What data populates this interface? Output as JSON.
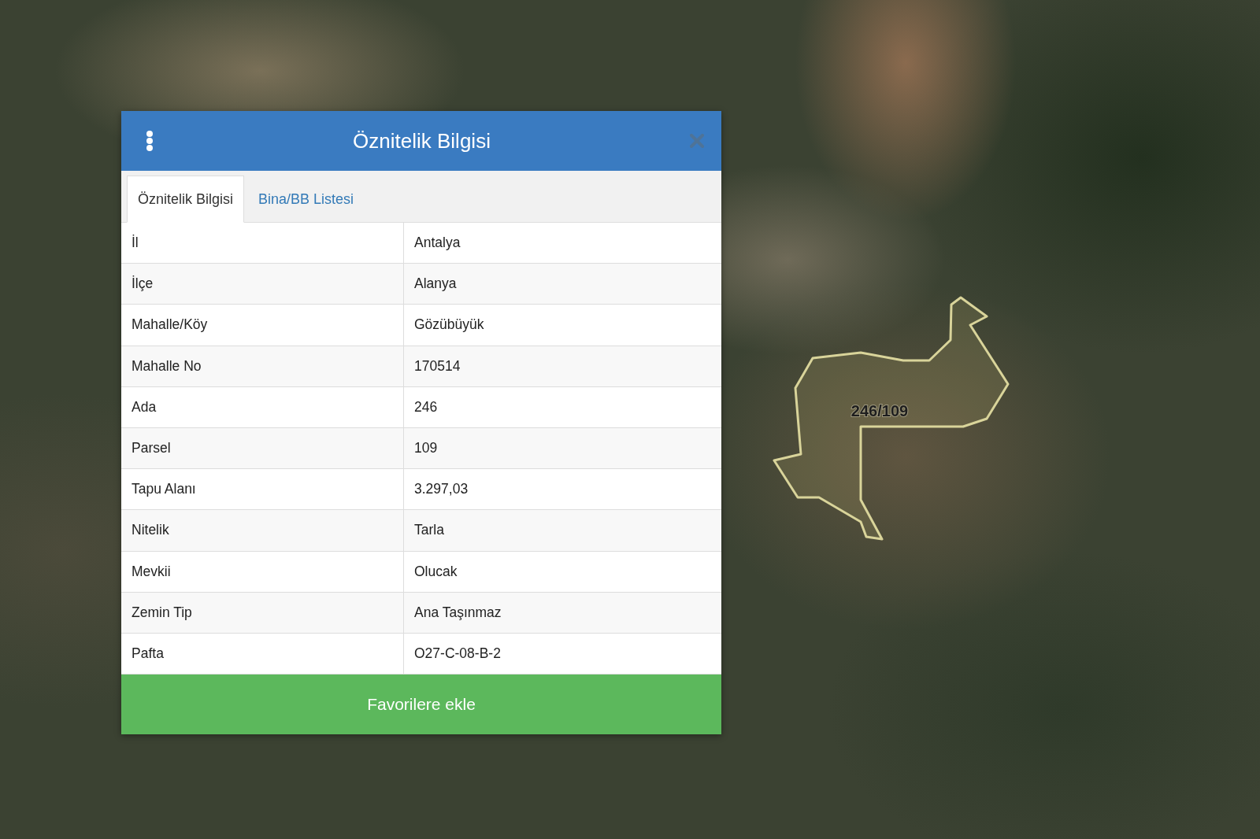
{
  "map": {
    "parcel": {
      "label": "246/109"
    }
  },
  "dialog": {
    "title": "Öznitelik Bilgisi",
    "tabs": [
      {
        "label": "Öznitelik Bilgisi",
        "selected": true
      },
      {
        "label": "Bina/BB Listesi",
        "selected": false
      }
    ],
    "table": {
      "rows": [
        {
          "label": "İl",
          "value": "Antalya"
        },
        {
          "label": "İlçe",
          "value": "Alanya"
        },
        {
          "label": "Mahalle/Köy",
          "value": "Gözübüyük"
        },
        {
          "label": "Mahalle No",
          "value": "170514"
        },
        {
          "label": "Ada",
          "value": "246"
        },
        {
          "label": "Parsel",
          "value": "109"
        },
        {
          "label": "Tapu Alanı",
          "value": "3.297,03"
        },
        {
          "label": "Nitelik",
          "value": "Tarla"
        },
        {
          "label": "Mevkii",
          "value": "Olucak"
        },
        {
          "label": "Zemin Tip",
          "value": "Ana Taşınmaz"
        },
        {
          "label": "Pafta",
          "value": "O27-C-08-B-2"
        }
      ]
    },
    "button": "Favorilere ekle"
  }
}
